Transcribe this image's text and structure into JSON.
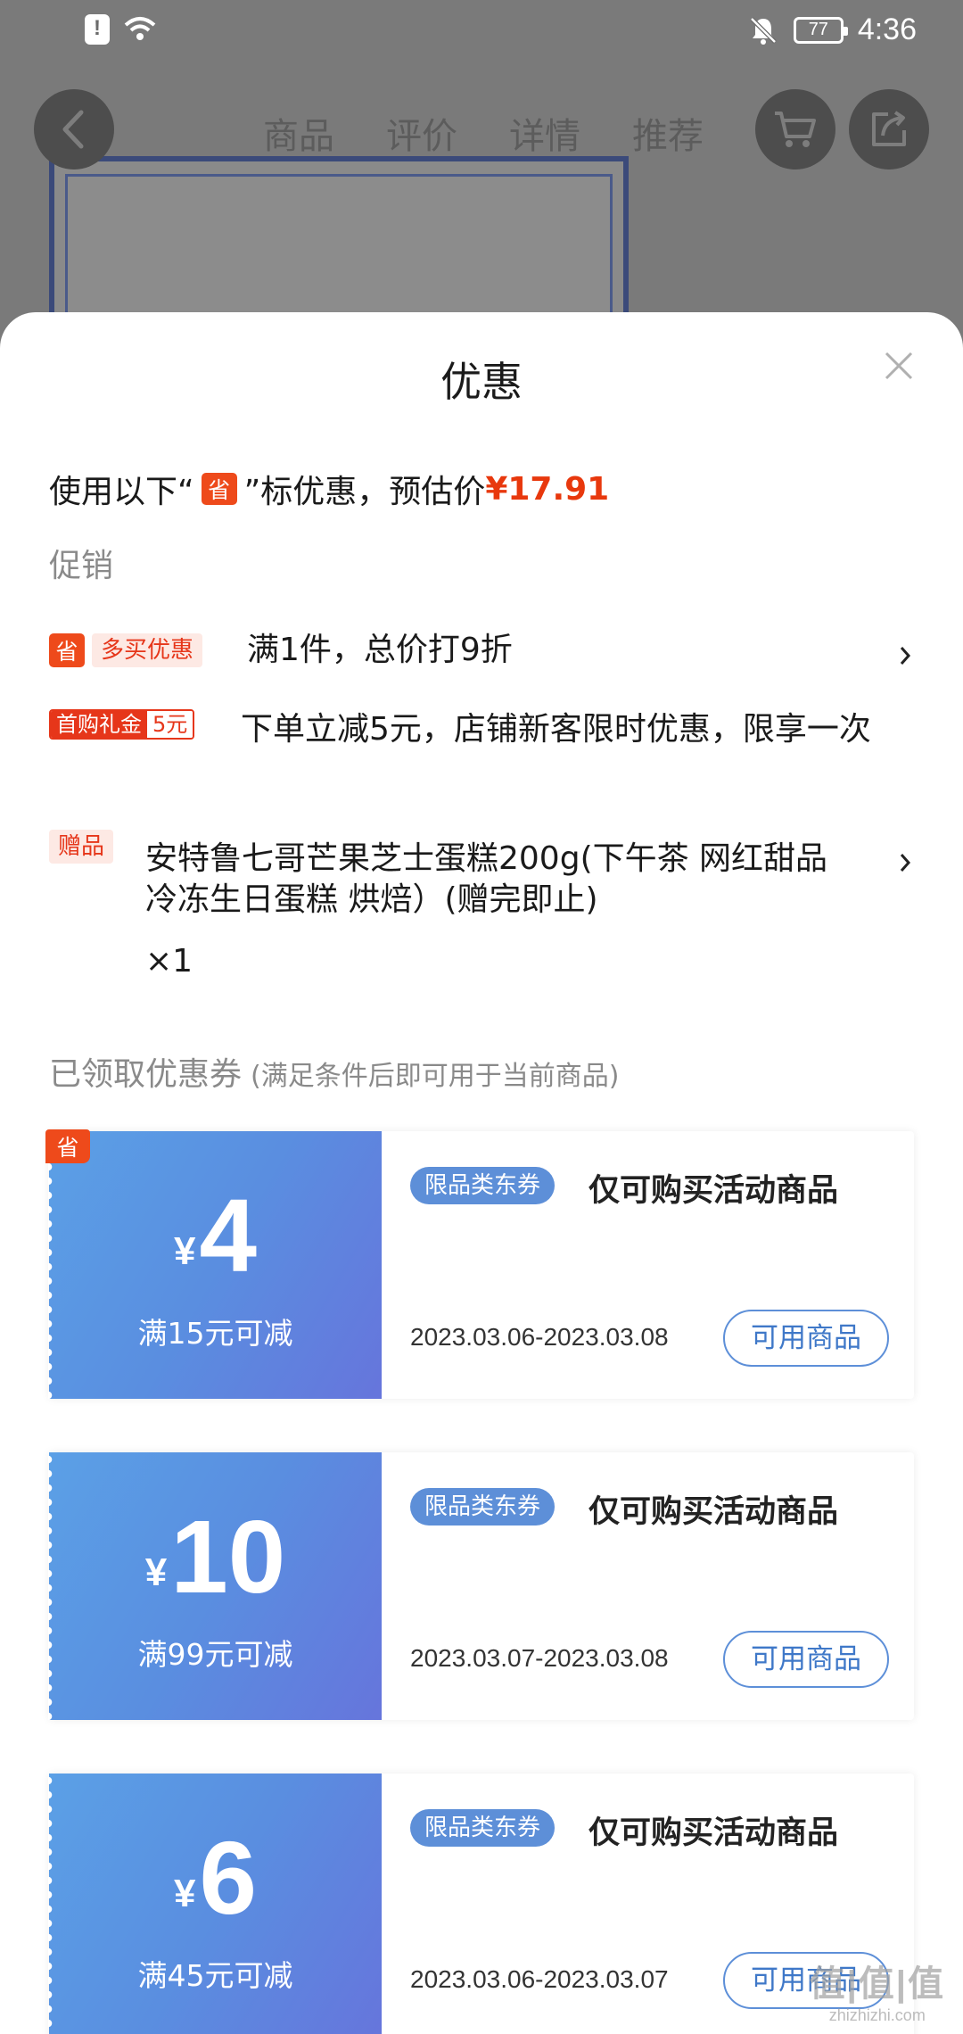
{
  "status_bar": {
    "battery": "77",
    "time": "4:36"
  },
  "nav": {
    "tabs": [
      "商品",
      "评价",
      "详情",
      "推荐"
    ]
  },
  "sheet": {
    "title": "优惠",
    "summary": {
      "prefix": "使用以下“",
      "badge": "省",
      "suffix": "”标优惠，预估价",
      "price": "¥17.91"
    },
    "promo_section_label": "促销",
    "promos": [
      {
        "badge": "省",
        "tag": "多买优惠",
        "text": "满1件，总价打9折"
      },
      {
        "tag_left": "首购礼金",
        "tag_right": "5元",
        "text": "下单立减5元，店铺新客限时优惠，限享一次"
      },
      {
        "tag": "赠品",
        "text": "安特鲁七哥芒果芝士蛋糕200g(下午茶 网红甜品 冷冻生日蛋糕 烘焙）(赠完即止)",
        "qty": "×1"
      }
    ],
    "coupon_section": {
      "label": "已领取优惠券",
      "sub": "(满足条件后即可用于当前商品)"
    },
    "coupons": [
      {
        "corner_badge": "省",
        "yen": "¥",
        "amount": "4",
        "condition": "满15元可减",
        "type": "限品类东券",
        "desc": "仅可购买活动商品",
        "date": "2023.03.06-2023.03.08",
        "button": "可用商品"
      },
      {
        "yen": "¥",
        "amount": "10",
        "condition": "满99元可减",
        "type": "限品类东券",
        "desc": "仅可购买活动商品",
        "date": "2023.03.07-2023.03.08",
        "button": "可用商品"
      },
      {
        "yen": "¥",
        "amount": "6",
        "condition": "满45元可减",
        "type": "限品类东券",
        "desc": "仅可购买活动商品",
        "date": "2023.03.06-2023.03.07",
        "button": "可用商品"
      }
    ]
  },
  "watermark": {
    "big": "值|值|值",
    "small": "zhizhizhi.com"
  }
}
